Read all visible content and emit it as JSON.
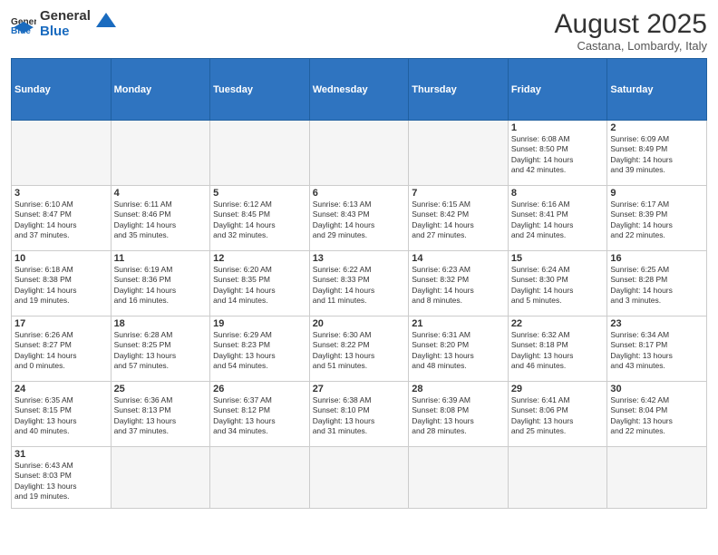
{
  "header": {
    "logo_general": "General",
    "logo_blue": "Blue",
    "month_title": "August 2025",
    "location": "Castana, Lombardy, Italy"
  },
  "weekdays": [
    "Sunday",
    "Monday",
    "Tuesday",
    "Wednesday",
    "Thursday",
    "Friday",
    "Saturday"
  ],
  "weeks": [
    [
      {
        "day": "",
        "info": ""
      },
      {
        "day": "",
        "info": ""
      },
      {
        "day": "",
        "info": ""
      },
      {
        "day": "",
        "info": ""
      },
      {
        "day": "",
        "info": ""
      },
      {
        "day": "1",
        "info": "Sunrise: 6:08 AM\nSunset: 8:50 PM\nDaylight: 14 hours\nand 42 minutes."
      },
      {
        "day": "2",
        "info": "Sunrise: 6:09 AM\nSunset: 8:49 PM\nDaylight: 14 hours\nand 39 minutes."
      }
    ],
    [
      {
        "day": "3",
        "info": "Sunrise: 6:10 AM\nSunset: 8:47 PM\nDaylight: 14 hours\nand 37 minutes."
      },
      {
        "day": "4",
        "info": "Sunrise: 6:11 AM\nSunset: 8:46 PM\nDaylight: 14 hours\nand 35 minutes."
      },
      {
        "day": "5",
        "info": "Sunrise: 6:12 AM\nSunset: 8:45 PM\nDaylight: 14 hours\nand 32 minutes."
      },
      {
        "day": "6",
        "info": "Sunrise: 6:13 AM\nSunset: 8:43 PM\nDaylight: 14 hours\nand 29 minutes."
      },
      {
        "day": "7",
        "info": "Sunrise: 6:15 AM\nSunset: 8:42 PM\nDaylight: 14 hours\nand 27 minutes."
      },
      {
        "day": "8",
        "info": "Sunrise: 6:16 AM\nSunset: 8:41 PM\nDaylight: 14 hours\nand 24 minutes."
      },
      {
        "day": "9",
        "info": "Sunrise: 6:17 AM\nSunset: 8:39 PM\nDaylight: 14 hours\nand 22 minutes."
      }
    ],
    [
      {
        "day": "10",
        "info": "Sunrise: 6:18 AM\nSunset: 8:38 PM\nDaylight: 14 hours\nand 19 minutes."
      },
      {
        "day": "11",
        "info": "Sunrise: 6:19 AM\nSunset: 8:36 PM\nDaylight: 14 hours\nand 16 minutes."
      },
      {
        "day": "12",
        "info": "Sunrise: 6:20 AM\nSunset: 8:35 PM\nDaylight: 14 hours\nand 14 minutes."
      },
      {
        "day": "13",
        "info": "Sunrise: 6:22 AM\nSunset: 8:33 PM\nDaylight: 14 hours\nand 11 minutes."
      },
      {
        "day": "14",
        "info": "Sunrise: 6:23 AM\nSunset: 8:32 PM\nDaylight: 14 hours\nand 8 minutes."
      },
      {
        "day": "15",
        "info": "Sunrise: 6:24 AM\nSunset: 8:30 PM\nDaylight: 14 hours\nand 5 minutes."
      },
      {
        "day": "16",
        "info": "Sunrise: 6:25 AM\nSunset: 8:28 PM\nDaylight: 14 hours\nand 3 minutes."
      }
    ],
    [
      {
        "day": "17",
        "info": "Sunrise: 6:26 AM\nSunset: 8:27 PM\nDaylight: 14 hours\nand 0 minutes."
      },
      {
        "day": "18",
        "info": "Sunrise: 6:28 AM\nSunset: 8:25 PM\nDaylight: 13 hours\nand 57 minutes."
      },
      {
        "day": "19",
        "info": "Sunrise: 6:29 AM\nSunset: 8:23 PM\nDaylight: 13 hours\nand 54 minutes."
      },
      {
        "day": "20",
        "info": "Sunrise: 6:30 AM\nSunset: 8:22 PM\nDaylight: 13 hours\nand 51 minutes."
      },
      {
        "day": "21",
        "info": "Sunrise: 6:31 AM\nSunset: 8:20 PM\nDaylight: 13 hours\nand 48 minutes."
      },
      {
        "day": "22",
        "info": "Sunrise: 6:32 AM\nSunset: 8:18 PM\nDaylight: 13 hours\nand 46 minutes."
      },
      {
        "day": "23",
        "info": "Sunrise: 6:34 AM\nSunset: 8:17 PM\nDaylight: 13 hours\nand 43 minutes."
      }
    ],
    [
      {
        "day": "24",
        "info": "Sunrise: 6:35 AM\nSunset: 8:15 PM\nDaylight: 13 hours\nand 40 minutes."
      },
      {
        "day": "25",
        "info": "Sunrise: 6:36 AM\nSunset: 8:13 PM\nDaylight: 13 hours\nand 37 minutes."
      },
      {
        "day": "26",
        "info": "Sunrise: 6:37 AM\nSunset: 8:12 PM\nDaylight: 13 hours\nand 34 minutes."
      },
      {
        "day": "27",
        "info": "Sunrise: 6:38 AM\nSunset: 8:10 PM\nDaylight: 13 hours\nand 31 minutes."
      },
      {
        "day": "28",
        "info": "Sunrise: 6:39 AM\nSunset: 8:08 PM\nDaylight: 13 hours\nand 28 minutes."
      },
      {
        "day": "29",
        "info": "Sunrise: 6:41 AM\nSunset: 8:06 PM\nDaylight: 13 hours\nand 25 minutes."
      },
      {
        "day": "30",
        "info": "Sunrise: 6:42 AM\nSunset: 8:04 PM\nDaylight: 13 hours\nand 22 minutes."
      }
    ],
    [
      {
        "day": "31",
        "info": "Sunrise: 6:43 AM\nSunset: 8:03 PM\nDaylight: 13 hours\nand 19 minutes."
      },
      {
        "day": "",
        "info": ""
      },
      {
        "day": "",
        "info": ""
      },
      {
        "day": "",
        "info": ""
      },
      {
        "day": "",
        "info": ""
      },
      {
        "day": "",
        "info": ""
      },
      {
        "day": "",
        "info": ""
      }
    ]
  ]
}
